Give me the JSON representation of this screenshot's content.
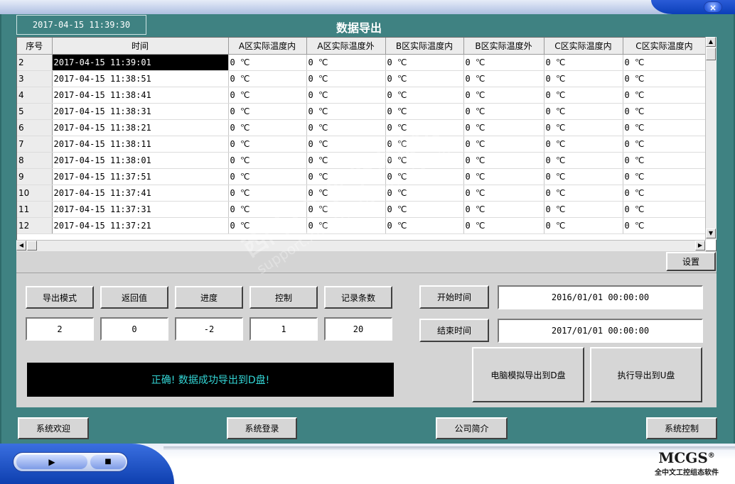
{
  "window": {
    "close_label": "×"
  },
  "header": {
    "datetime": "2017-04-15 11:39:30",
    "title": "数据导出"
  },
  "table": {
    "columns": [
      "序号",
      "时间",
      "A区实际温度内",
      "A区实际温度外",
      "B区实际温度内",
      "B区实际温度外",
      "C区实际温度内",
      "C区实际温度内"
    ],
    "rows": [
      {
        "seq": "2",
        "time": "2017-04-15 11:39:01",
        "vals": [
          "0 ℃",
          "0 ℃",
          "0 ℃",
          "0 ℃",
          "0 ℃",
          "0 ℃"
        ]
      },
      {
        "seq": "3",
        "time": "2017-04-15 11:38:51",
        "vals": [
          "0 ℃",
          "0 ℃",
          "0 ℃",
          "0 ℃",
          "0 ℃",
          "0 ℃"
        ]
      },
      {
        "seq": "4",
        "time": "2017-04-15 11:38:41",
        "vals": [
          "0 ℃",
          "0 ℃",
          "0 ℃",
          "0 ℃",
          "0 ℃",
          "0 ℃"
        ]
      },
      {
        "seq": "5",
        "time": "2017-04-15 11:38:31",
        "vals": [
          "0 ℃",
          "0 ℃",
          "0 ℃",
          "0 ℃",
          "0 ℃",
          "0 ℃"
        ]
      },
      {
        "seq": "6",
        "time": "2017-04-15 11:38:21",
        "vals": [
          "0 ℃",
          "0 ℃",
          "0 ℃",
          "0 ℃",
          "0 ℃",
          "0 ℃"
        ]
      },
      {
        "seq": "7",
        "time": "2017-04-15 11:38:11",
        "vals": [
          "0 ℃",
          "0 ℃",
          "0 ℃",
          "0 ℃",
          "0 ℃",
          "0 ℃"
        ]
      },
      {
        "seq": "8",
        "time": "2017-04-15 11:38:01",
        "vals": [
          "0 ℃",
          "0 ℃",
          "0 ℃",
          "0 ℃",
          "0 ℃",
          "0 ℃"
        ]
      },
      {
        "seq": "9",
        "time": "2017-04-15 11:37:51",
        "vals": [
          "0 ℃",
          "0 ℃",
          "0 ℃",
          "0 ℃",
          "0 ℃",
          "0 ℃"
        ]
      },
      {
        "seq": "10",
        "time": "2017-04-15 11:37:41",
        "vals": [
          "0 ℃",
          "0 ℃",
          "0 ℃",
          "0 ℃",
          "0 ℃",
          "0 ℃"
        ]
      },
      {
        "seq": "11",
        "time": "2017-04-15 11:37:31",
        "vals": [
          "0 ℃",
          "0 ℃",
          "0 ℃",
          "0 ℃",
          "0 ℃",
          "0 ℃"
        ]
      },
      {
        "seq": "12",
        "time": "2017-04-15 11:37:21",
        "vals": [
          "0 ℃",
          "0 ℃",
          "0 ℃",
          "0 ℃",
          "0 ℃",
          "0 ℃"
        ]
      }
    ],
    "selected_row": 0,
    "scroll_up": "▲",
    "scroll_down": "▼",
    "scroll_left": "◀",
    "scroll_right": "▶"
  },
  "settings_button": "设置",
  "controls": {
    "labels": [
      "导出模式",
      "返回值",
      "进度",
      "控制",
      "记录条数"
    ],
    "values": [
      "2",
      "0",
      "-2",
      "1",
      "20"
    ]
  },
  "time_range": {
    "start_label": "开始时间",
    "start_value": "2016/01/01 00:00:00",
    "end_label": "结束时间",
    "end_value": "2017/01/01 00:00:00"
  },
  "status_message": "正确! 数据成功导出到D盘!",
  "export_buttons": {
    "simulate": "电脑模拟导出到D盘",
    "execute": "执行导出到U盘"
  },
  "nav": [
    "系统欢迎",
    "系统登录",
    "公司简介",
    "系统控制"
  ],
  "player": {
    "play": "▶",
    "stop": "■"
  },
  "logo": {
    "name": "MCGS",
    "reg": "®",
    "tagline": "全中文工控组态软件"
  },
  "watermark": {
    "line1": "西门子工业 技术论坛",
    "line2": "support.industry.siemens.com/cs"
  },
  "colors": {
    "background": "#3f8282",
    "status_text": "#33d6d6",
    "panel": "#d4d4d4"
  }
}
